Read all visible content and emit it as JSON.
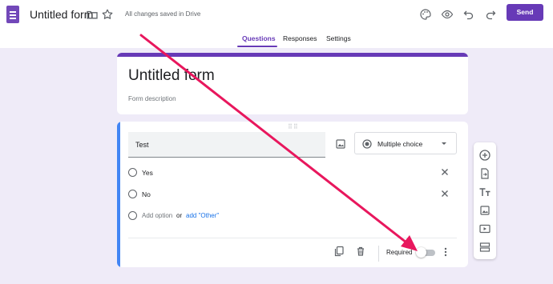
{
  "header": {
    "title": "Untitled form",
    "saved_status": "All changes saved in Drive",
    "send_label": "Send",
    "icons": [
      "forms-logo-icon",
      "folder-icon",
      "star-icon",
      "palette-icon",
      "preview-eye-icon",
      "undo-icon",
      "redo-icon"
    ]
  },
  "tabs": [
    {
      "label": "Questions",
      "active": true
    },
    {
      "label": "Responses",
      "active": false
    },
    {
      "label": "Settings",
      "active": false
    }
  ],
  "form": {
    "title": "Untitled form",
    "description_placeholder": "Form description"
  },
  "question": {
    "title": "Test",
    "type": "Multiple choice",
    "options": [
      {
        "label": "Yes"
      },
      {
        "label": "No"
      }
    ],
    "add_option": "Add option",
    "or": "or",
    "add_other": "add \"Other\"",
    "required_label": "Required",
    "required": false
  },
  "side_toolbar": {
    "items": [
      "add-question-icon",
      "import-questions-icon",
      "add-title-icon",
      "add-image-icon",
      "add-video-icon",
      "add-section-icon"
    ]
  },
  "colors": {
    "accent": "#673ab7",
    "background": "#efebf8",
    "question_bar": "#4285f4",
    "link": "#1a73e8",
    "annotation_arrow": "#e8175d"
  }
}
